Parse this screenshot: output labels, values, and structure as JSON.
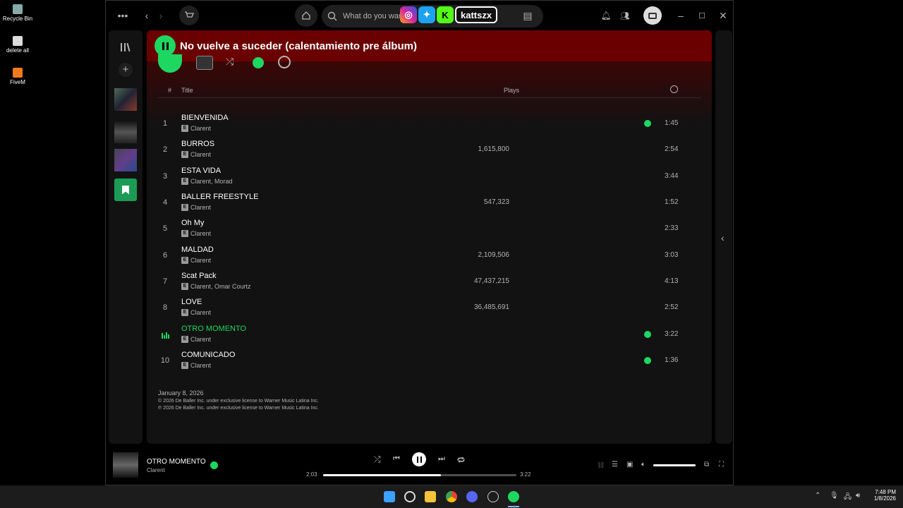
{
  "desktop": {
    "icons": [
      {
        "label": "Recycle Bin"
      },
      {
        "label": "delete all"
      },
      {
        "label": "FiveM"
      }
    ]
  },
  "search": {
    "placeholder": "What do you wan"
  },
  "overlay": {
    "handle": "kattszx"
  },
  "banner": {
    "title": "No vuelve a suceder (calentamiento pre álbum)"
  },
  "tracklist": {
    "headers": {
      "num": "#",
      "title": "Title",
      "plays": "Plays"
    },
    "tracks": [
      {
        "num": "1",
        "title": "BIENVENIDA",
        "artist": "Clarent",
        "plays": "",
        "saved": true,
        "duration": "1:45",
        "explicit": "E"
      },
      {
        "num": "2",
        "title": "BURROS",
        "artist": "Clarent",
        "plays": "1,615,800",
        "saved": false,
        "duration": "2:54",
        "explicit": "E"
      },
      {
        "num": "3",
        "title": "ESTA VIDA",
        "artist": "Clarent, Morad",
        "plays": "",
        "saved": false,
        "duration": "3:44",
        "explicit": "E"
      },
      {
        "num": "4",
        "title": "BALLER FREESTYLE",
        "artist": "Clarent",
        "plays": "547,323",
        "saved": false,
        "duration": "1:52",
        "explicit": "E"
      },
      {
        "num": "5",
        "title": "Oh My",
        "artist": "Clarent",
        "plays": "",
        "saved": false,
        "duration": "2:33",
        "explicit": "E"
      },
      {
        "num": "6",
        "title": "MALDAD",
        "artist": "Clarent",
        "plays": "2,109,506",
        "saved": false,
        "duration": "3:03",
        "explicit": "E"
      },
      {
        "num": "7",
        "title": "Scat Pack",
        "artist": "Clarent, Omar Courtz",
        "plays": "47,437,215",
        "saved": false,
        "duration": "4:13",
        "explicit": "E"
      },
      {
        "num": "8",
        "title": "LOVE",
        "artist": "Clarent",
        "plays": "36,485,691",
        "saved": false,
        "duration": "2:52",
        "explicit": "E"
      },
      {
        "num": "",
        "title": "OTRO MOMENTO",
        "artist": "Clarent",
        "plays": "",
        "saved": true,
        "duration": "3:22",
        "explicit": "E",
        "playing": true
      },
      {
        "num": "10",
        "title": "COMUNICADO",
        "artist": "Clarent",
        "plays": "",
        "saved": true,
        "duration": "1:36",
        "explicit": "E"
      }
    ]
  },
  "release": {
    "date": "January 8, 2026",
    "copyright": "© 2026 De Baller Inc. under exclusive license to Warner Music Latina Inc.",
    "phonogram": "℗ 2026 De Baller Inc. under exclusive license to Warner Music Latina Inc."
  },
  "now_playing": {
    "title": "OTRO MOMENTO",
    "artist": "Clarent",
    "elapsed": "2:03",
    "total": "3:22",
    "progress": 0.61,
    "volume": 1.0
  },
  "clock": {
    "time": "7:48 PM",
    "date": "1/8/2026"
  },
  "colors": {
    "accent": "#1ed760",
    "banner": "#6b0000"
  }
}
